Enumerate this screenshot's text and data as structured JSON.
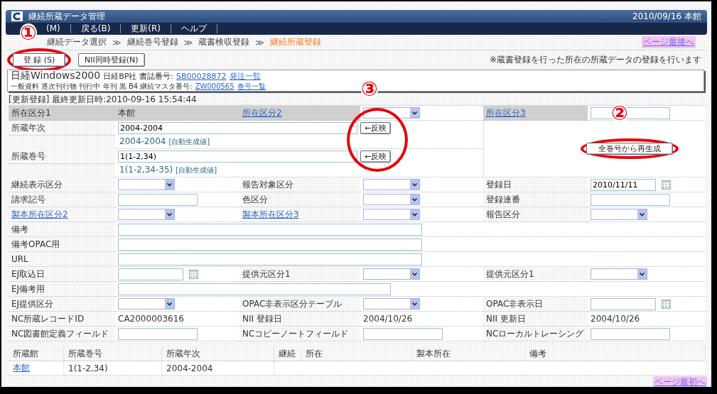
{
  "window": {
    "title": "継続所蔵データ管理",
    "status": "2010/09/16 本館"
  },
  "menu": [
    {
      "label": "(M)"
    },
    {
      "label": "戻る(B)"
    },
    {
      "label": "更新(R)"
    },
    {
      "label": "ヘルプ"
    }
  ],
  "breadcrumb": [
    {
      "label": "継続データ選択",
      "current": false
    },
    {
      "label": "継続巻号登録",
      "current": false
    },
    {
      "label": "蔵書検収登録",
      "current": false
    },
    {
      "label": "継続所蔵登録",
      "current": true
    }
  ],
  "breadcrumb_separator": "≫",
  "top_link": "ページ最後へ",
  "buttons": [
    "登 録 (S)",
    "NII同時登録(N)"
  ],
  "note": "※蔵書登録を行った所在の所蔵データの登録を行います",
  "record": {
    "title": "日経Windows2000",
    "publisher": "日経BP社",
    "id_label": "書誌番号:",
    "id": "SB00028872",
    "id_link": "発注一覧",
    "details": "一般資料 逐次刊行物 刊行中 年刊 黒 B4 継続マスタ番号:",
    "master": "ZW000565",
    "master_link": "巻号一覧"
  },
  "update_info": "[更新登録] 最終更新日時:2010-09-16 15:54:44",
  "form": [
    {
      "shaded": true,
      "cells": [
        {
          "kind": "label",
          "text": "所在区分1"
        },
        {
          "kind": "text",
          "text": "本館"
        },
        {
          "kind": "link_label",
          "text": "所在区分2"
        },
        {
          "kind": "select"
        },
        {
          "kind": "link_label",
          "text": "所在区分3"
        },
        {
          "kind": "input"
        }
      ]
    },
    {
      "shaded": false,
      "cells": [
        {
          "kind": "label",
          "text": "所蔵年次"
        },
        {
          "kind": "reflect",
          "value": "2004-2004",
          "button": "←反映",
          "hint": "2004-2004",
          "hint_note": "[自動生成値]"
        },
        {
          "kind": "regen",
          "label": "全巻号から再生成"
        }
      ]
    },
    {
      "shaded": false,
      "cells": [
        {
          "kind": "label",
          "text": "所蔵巻号"
        },
        {
          "kind": "reflect",
          "value": "1(1-2,34)",
          "button": "←反映",
          "hint": "1(1-2,34-35)",
          "hint_note": "[自動生成値]"
        }
      ]
    },
    {
      "shaded": false,
      "cells": [
        {
          "kind": "label",
          "text": "継続表示区分"
        },
        {
          "kind": "select"
        },
        {
          "kind": "label",
          "text": "報告対象区分"
        },
        {
          "kind": "select"
        },
        {
          "kind": "label",
          "text": "登録日"
        },
        {
          "kind": "date",
          "value": "2010/11/11"
        }
      ]
    },
    {
      "shaded": false,
      "cells": [
        {
          "kind": "label",
          "text": "請求記号"
        },
        {
          "kind": "input"
        },
        {
          "kind": "label",
          "text": "色区分"
        },
        {
          "kind": "select"
        },
        {
          "kind": "label",
          "text": "登録連番"
        },
        {
          "kind": "input"
        }
      ]
    },
    {
      "shaded": false,
      "cells": [
        {
          "kind": "link_label",
          "text": "製本所在区分2"
        },
        {
          "kind": "select"
        },
        {
          "kind": "link_label",
          "text": "製本所在区分3"
        },
        {
          "kind": "select"
        },
        {
          "kind": "label",
          "text": "報告区分"
        },
        {
          "kind": "select"
        }
      ]
    },
    {
      "shaded": false,
      "cells": [
        {
          "kind": "label",
          "text": "備考"
        },
        {
          "kind": "wide_input"
        }
      ]
    },
    {
      "shaded": false,
      "cells": [
        {
          "kind": "label",
          "text": "備考OPAC用"
        },
        {
          "kind": "wide_input"
        }
      ]
    },
    {
      "shaded": false,
      "cells": [
        {
          "kind": "label",
          "text": "URL"
        },
        {
          "kind": "wide_input"
        }
      ]
    },
    {
      "shaded": false,
      "cells": [
        {
          "kind": "label",
          "text": "EJ取込日"
        },
        {
          "kind": "date"
        },
        {
          "kind": "label",
          "text": "提供元区分1"
        },
        {
          "kind": "select"
        },
        {
          "kind": "label",
          "text": "提供元区分1"
        },
        {
          "kind": "select"
        }
      ]
    },
    {
      "shaded": false,
      "cells": [
        {
          "kind": "label",
          "text": "EJ備考用"
        },
        {
          "kind": "wide_input"
        }
      ]
    },
    {
      "shaded": false,
      "cells": [
        {
          "kind": "label",
          "text": "EJ提供区分"
        },
        {
          "kind": "select"
        },
        {
          "kind": "label",
          "text": "OPAC非表示区分テーブル"
        },
        {
          "kind": "select"
        },
        {
          "kind": "label",
          "text": "OPAC非表示日"
        },
        {
          "kind": "date"
        }
      ]
    },
    {
      "shaded": false,
      "cells": [
        {
          "kind": "label",
          "text": "NC所蔵レコードID"
        },
        {
          "kind": "text",
          "text": "CA2000003616"
        },
        {
          "kind": "label",
          "text": "NII 登録日"
        },
        {
          "kind": "text",
          "text": "2004/10/26"
        },
        {
          "kind": "label",
          "text": "NII 更新日"
        },
        {
          "kind": "text",
          "text": "2004/10/26"
        }
      ]
    },
    {
      "shaded": false,
      "cells": [
        {
          "kind": "label",
          "text": "NC図書館定義フィールド"
        },
        {
          "kind": "input"
        },
        {
          "kind": "label",
          "text": "NCコピーノートフィールド"
        },
        {
          "kind": "input"
        },
        {
          "kind": "label",
          "text": "NCローカルトレーシング"
        },
        {
          "kind": "input"
        }
      ]
    }
  ],
  "holdings": {
    "columns": [
      "所蔵館",
      "所蔵巻号",
      "所蔵年次",
      "継続",
      "所在",
      "製本所在",
      "備考"
    ],
    "rows": [
      [
        {
          "text": "本館",
          "kind": "link"
        },
        {
          "text": "1(1-2,34)",
          "kind": "text"
        },
        {
          "text": "2004-2004",
          "kind": "text"
        }
      ]
    ]
  },
  "bottom_link": "ページ最初へ",
  "annotations": [
    {
      "label": "①"
    },
    {
      "label": "②"
    },
    {
      "label": "③"
    }
  ]
}
